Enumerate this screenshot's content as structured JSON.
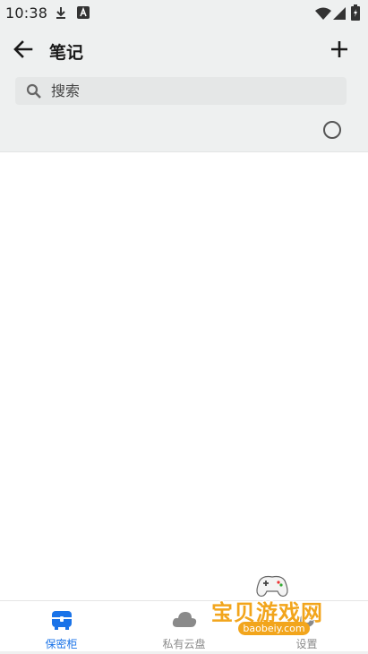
{
  "status_bar": {
    "time": "10:38",
    "icons": [
      "download-icon",
      "a-notification-icon",
      "wifi-icon",
      "signal-icon",
      "battery-icon"
    ]
  },
  "header": {
    "title": "笔记",
    "back_icon": "arrow-left-icon",
    "add_icon": "plus-icon"
  },
  "search": {
    "placeholder": "搜索",
    "value": ""
  },
  "notes": [],
  "bottom_nav": {
    "items": [
      {
        "label": "保密柜",
        "icon": "safe-box-icon",
        "active": true
      },
      {
        "label": "私有云盘",
        "icon": "cloud-icon",
        "active": false
      },
      {
        "label": "设置",
        "icon": "settings-icon",
        "active": false
      }
    ]
  },
  "watermark": {
    "text": "宝贝游戏网",
    "url": "baobeiy.com"
  },
  "colors": {
    "accent": "#1a73e8",
    "header_bg": "#eef0f0",
    "search_bg": "#e5e7e7",
    "watermark": "#f2a51c"
  }
}
